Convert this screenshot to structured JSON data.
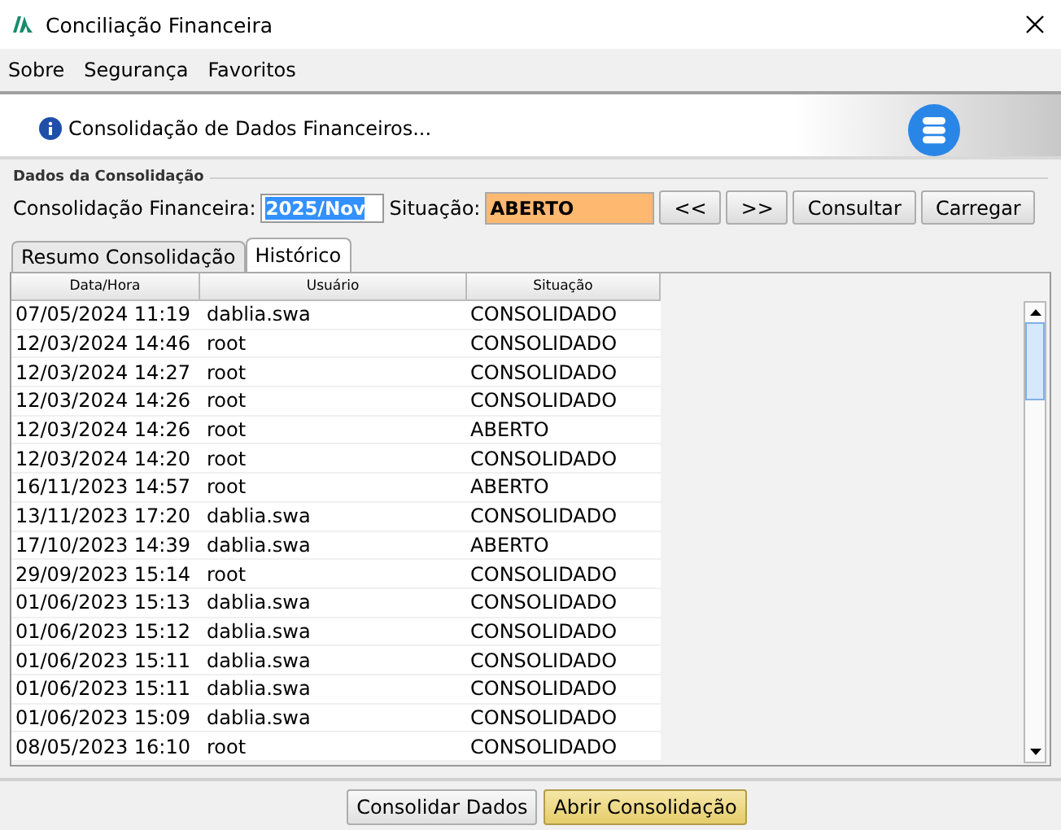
{
  "window": {
    "title": "Conciliação Financeira"
  },
  "menu": [
    "Sobre",
    "Segurança",
    "Favoritos"
  ],
  "banner": {
    "text": "Consolidação de Dados Financeiros..."
  },
  "group": {
    "title": "Dados da Consolidação",
    "period_label": "Consolidação Financeira:",
    "period_value": "2025/Nov",
    "status_label": "Situação:",
    "status_value": "ABERTO",
    "buttons": [
      "<<",
      ">>",
      "Consultar",
      "Carregar"
    ]
  },
  "tabs": [
    {
      "label": "Resumo Consolidação",
      "selected": false
    },
    {
      "label": "Histórico",
      "selected": true
    }
  ],
  "table": {
    "columns": [
      "Data/Hora",
      "Usuário",
      "Situação"
    ],
    "rows": [
      [
        "07/05/2024 11:19",
        "dablia.swa",
        "CONSOLIDADO"
      ],
      [
        "12/03/2024 14:46",
        "root",
        "CONSOLIDADO"
      ],
      [
        "12/03/2024 14:27",
        "root",
        "CONSOLIDADO"
      ],
      [
        "12/03/2024 14:26",
        "root",
        "CONSOLIDADO"
      ],
      [
        "12/03/2024 14:26",
        "root",
        "ABERTO"
      ],
      [
        "12/03/2024 14:20",
        "root",
        "CONSOLIDADO"
      ],
      [
        "16/11/2023 14:57",
        "root",
        "ABERTO"
      ],
      [
        "13/11/2023 17:20",
        "dablia.swa",
        "CONSOLIDADO"
      ],
      [
        "17/10/2023 14:39",
        "dablia.swa",
        "ABERTO"
      ],
      [
        "29/09/2023 15:14",
        "root",
        "CONSOLIDADO"
      ],
      [
        "01/06/2023 15:13",
        "dablia.swa",
        "CONSOLIDADO"
      ],
      [
        "01/06/2023 15:12",
        "dablia.swa",
        "CONSOLIDADO"
      ],
      [
        "01/06/2023 15:11",
        "dablia.swa",
        "CONSOLIDADO"
      ],
      [
        "01/06/2023 15:11",
        "dablia.swa",
        "CONSOLIDADO"
      ],
      [
        "01/06/2023 15:09",
        "dablia.swa",
        "CONSOLIDADO"
      ],
      [
        "08/05/2023 16:10",
        "root",
        "CONSOLIDADO"
      ]
    ]
  },
  "footer_buttons": [
    {
      "label": "Consolidar Dados",
      "kind": "normal"
    },
    {
      "label": "Abrir Consolidação",
      "kind": "default"
    }
  ]
}
